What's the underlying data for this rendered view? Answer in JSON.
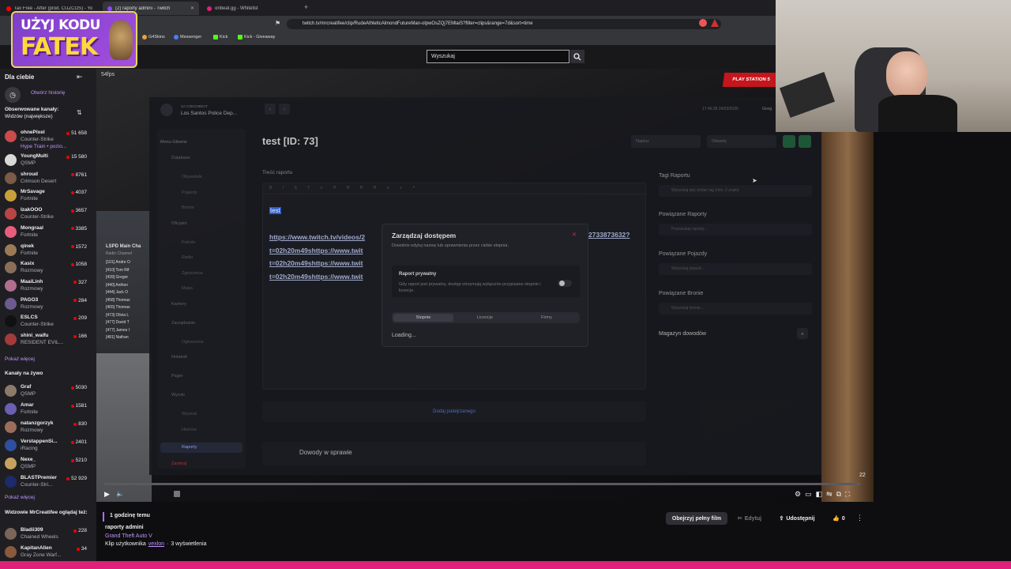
{
  "browser": {
    "tabs": [
      {
        "label": "Tax Free - After (prod. CUZCOS) - Yo",
        "active": false
      },
      {
        "label": "(2) raporty admini - Twitch",
        "active": true
      },
      {
        "label": "onbeat.gg - Whitelist",
        "active": false
      }
    ],
    "url": "twitch.tv/mrcreatifee/clip/RudeAthleticAlmondFutureMan-olpwOsZQj7EMlaiS?filter=clips&range=7d&sort=time",
    "bookmarks": [
      "G4Skins",
      "Messenger",
      "Kick",
      "Kick - Giveaway"
    ]
  },
  "overlay": {
    "promo_line1": "UŻYJ KODU",
    "promo_line2": "FATEK",
    "fps": "54fps",
    "play_station": "PLAY STATION 5"
  },
  "twitch": {
    "search_placeholder": "Wyszukaj",
    "sidebar": {
      "for_you": "Dla ciebie",
      "open_history": "Otwórz historię",
      "followed_title": "Obserwowane kanały:",
      "followed_sort": "Widzów (największe)",
      "followed": [
        {
          "name": "ohnePixel",
          "game": "Counter-Strike",
          "extra": "Hype Train • pozio...",
          "viewers": "51 658",
          "color": "#c94b4b"
        },
        {
          "name": "YoungMulti",
          "game": "QSMP",
          "viewers": "15 580",
          "color": "#d8d8d8"
        },
        {
          "name": "shroud",
          "game": "Crimson Desert",
          "viewers": "8761",
          "color": "#7a5b46"
        },
        {
          "name": "MrSavage",
          "game": "Fortnite",
          "viewers": "4037",
          "color": "#c9a13a"
        },
        {
          "name": "IzakOOO",
          "game": "Counter-Strike",
          "viewers": "3657",
          "color": "#b84545"
        },
        {
          "name": "Mongraal",
          "game": "Fortnite",
          "viewers": "3385",
          "color": "#e85d7c"
        },
        {
          "name": "qinek",
          "game": "Fortnite",
          "viewers": "1572",
          "color": "#9c7a55"
        },
        {
          "name": "Kasix",
          "game": "Rozmowy",
          "viewers": "1058",
          "color": "#8a6e5a"
        },
        {
          "name": "MaaiLinh",
          "game": "Rozmowy",
          "viewers": "327",
          "color": "#b06f8f"
        },
        {
          "name": "PAGO3",
          "game": "Rozmowy",
          "viewers": "284",
          "color": "#6d5a8f"
        },
        {
          "name": "ESLCS",
          "game": "Counter-Strike",
          "viewers": "209",
          "color": "#111111"
        },
        {
          "name": "shini_waifu",
          "game": "RESIDENT EVIL...",
          "viewers": "166",
          "color": "#a33b3b"
        }
      ],
      "show_more": "Pokaż więcej",
      "live_title": "Kanały na żywo",
      "live": [
        {
          "name": "Graf",
          "game": "QSMP",
          "viewers": "5030",
          "color": "#8e7a6a"
        },
        {
          "name": "Amar",
          "game": "Fortnite",
          "viewers": "1581",
          "color": "#6a5fb0"
        },
        {
          "name": "natanzgorzyk",
          "game": "Rozmowy",
          "viewers": "830",
          "color": "#9c6d5a"
        },
        {
          "name": "VerstappenSi...",
          "game": "iRacing",
          "viewers": "2401",
          "color": "#2f4f9f"
        },
        {
          "name": "Nexe_",
          "game": "QSMP",
          "viewers": "5210",
          "color": "#c7a15e"
        },
        {
          "name": "BLASTPremier",
          "game": "Counter-Stri...",
          "viewers": "52 929",
          "color": "#1d2a6b"
        }
      ],
      "show_more2": "Pokaż więcej",
      "also_title": "Widzowie MrCreatifee oglądaj też:",
      "also": [
        {
          "name": "Bladii309",
          "game": "Chained Wheels",
          "viewers": "228",
          "color": "#7a6658"
        },
        {
          "name": "KapitanAlien",
          "game": "Gray Zone Warf...",
          "viewers": "34",
          "color": "#8a5a3c"
        }
      ]
    },
    "clip": {
      "time_ago": "1 godzinę temu",
      "title": "raporty admini",
      "game": "Grand Theft Auto V",
      "clip_by_prefix": "Klip użytkownika",
      "clip_author": "vexlon",
      "views": "3 wyświetlenia",
      "full_movie": "Obejrzyj pełny film",
      "edit": "Edytuj",
      "share": "Udostępnij",
      "likes": "0"
    },
    "player": {
      "time": "22",
      "progress": 0.0
    }
  },
  "game_panel": {
    "org_sub": "SA CZECHBEAT",
    "org_name": "Los Santos Police Dep...",
    "datetime": "17:46:28 24/03/2026",
    "user": "Greg",
    "menu_title": "Menu Główne",
    "menu": [
      {
        "label": "Database",
        "group": true
      },
      {
        "label": "Obywatele",
        "group": false
      },
      {
        "label": "Pojazdy",
        "group": false
      },
      {
        "label": "Bronie",
        "group": false
      },
      {
        "label": "Oficjalni",
        "group": true
      },
      {
        "label": "Patrole",
        "group": false
      },
      {
        "label": "Radio",
        "group": false
      },
      {
        "label": "Zgłoszenia",
        "group": false
      },
      {
        "label": "Mapa",
        "group": false
      },
      {
        "label": "Kamery",
        "group": true
      },
      {
        "label": "Zarządzanie",
        "group": true
      },
      {
        "label": "Ogłoszenia",
        "group": false
      },
      {
        "label": "Notatnik",
        "group": true
      },
      {
        "label": "Pager",
        "group": true
      },
      {
        "label": "Wyroki",
        "group": true
      },
      {
        "label": "Wyszuk",
        "group": false
      },
      {
        "label": "Historia",
        "group": false
      },
      {
        "label": "Raporty",
        "group": true,
        "active": true
      },
      {
        "label": "Zamknij",
        "group": true,
        "danger": true
      }
    ],
    "report_title": "test [ID: 73]",
    "select_author": "Napisz",
    "select_status": "Otwarty",
    "content_label": "Treść raportu",
    "content_highlight": "test",
    "content_links": [
      "https://www.twitch.tv/videos/2",
      "t=02h20m49shttps://www.twit",
      "t=02h20m49shttps://www.twit",
      "t=02h20m49shttps://www.twit"
    ],
    "content_link_tail": "2733873632?",
    "tags_label": "Tagi Raportu",
    "tags_placeholder": "Wyszukaj aby dodać tag (min. 2 znaki)",
    "related_reports": "Powiązane Raporty",
    "related_reports_ph": "Przeszukaj raporty...",
    "related_vehicles": "Powiązane Pojazdy",
    "related_vehicles_ph": "Wyszukaj pojazd...",
    "related_weapons": "Powiązane Bronie",
    "related_weapons_ph": "Wyszukaj bronie...",
    "evidence": "Magazyn dowodów",
    "add_suspect": "Dodaj podejrzanego",
    "evidence_case": "Dowody w sprawie",
    "radio_title": "LSPD Main Cha",
    "radio_sub": "Radio Channel",
    "radio_list": [
      "[101] Andre O",
      "[410] Tom Rif",
      "[439] Gregor",
      "[440] Anthon",
      "[444] Jack O",
      "[458] Thomas",
      "[465] Thomas",
      "[473] Olivia L",
      "[477] David T",
      "[477] James I",
      "[481] Nathan"
    ]
  },
  "modal": {
    "title": "Zarządzaj dostępem",
    "desc": "Dowolnie edytuj nazwę lub uprawnienia przez ciebie stopnia.",
    "private_label": "Raport prywatny",
    "private_desc": "Gdy raport jest prywatny, dostęp otrzymują wyłącznie przypisane stopnie i licencje.",
    "tabs": [
      "Stopnie",
      "Licencje",
      "Firmy"
    ],
    "loading": "Loading..."
  }
}
